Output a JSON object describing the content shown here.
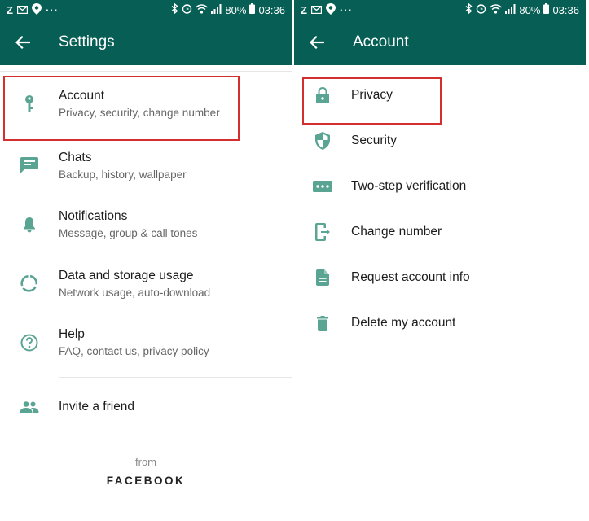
{
  "status_bar": {
    "battery": "80%",
    "time": "03:36",
    "overflow": "···"
  },
  "left_screen": {
    "title": "Settings",
    "items": [
      {
        "label": "Account",
        "subtitle": "Privacy, security, change number",
        "icon": "key-icon"
      },
      {
        "label": "Chats",
        "subtitle": "Backup, history, wallpaper",
        "icon": "chat-icon"
      },
      {
        "label": "Notifications",
        "subtitle": "Message, group & call tones",
        "icon": "bell-icon"
      },
      {
        "label": "Data and storage usage",
        "subtitle": "Network usage, auto-download",
        "icon": "data-usage-icon"
      },
      {
        "label": "Help",
        "subtitle": "FAQ, contact us, privacy policy",
        "icon": "help-icon"
      }
    ],
    "invite": {
      "label": "Invite a friend",
      "icon": "people-icon"
    },
    "footer": {
      "from": "from",
      "brand": "FACEBOOK"
    }
  },
  "right_screen": {
    "title": "Account",
    "items": [
      {
        "label": "Privacy",
        "icon": "lock-icon"
      },
      {
        "label": "Security",
        "icon": "shield-icon"
      },
      {
        "label": "Two-step verification",
        "icon": "dots-icon"
      },
      {
        "label": "Change number",
        "icon": "phone-change-icon"
      },
      {
        "label": "Request account info",
        "icon": "document-icon"
      },
      {
        "label": "Delete my account",
        "icon": "trash-icon"
      }
    ]
  },
  "colors": {
    "header": "#075e54",
    "icon": "#5aa493",
    "highlight": "#d32f2f"
  }
}
